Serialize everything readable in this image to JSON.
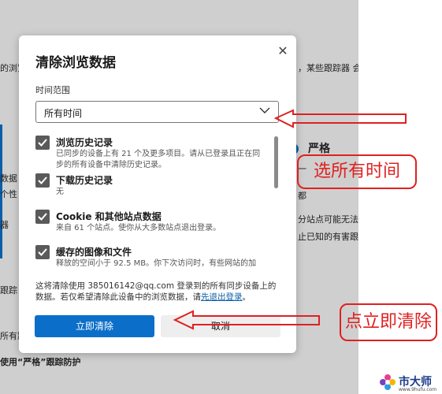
{
  "background": {
    "top_left_text": "的浏览",
    "top_right_text": "，某些跟踪器 会",
    "strict_label": "严格",
    "left_fragments": [
      "数据",
      "个性",
      "器",
      "跟踪",
      "所有跟"
    ],
    "right_fragments": [
      "一",
      "都",
      "分站点可能无法",
      "止已知的有害跟"
    ],
    "bottom_text": "使用“严格”跟踪防护"
  },
  "dialog": {
    "title": "清除浏览数据",
    "close_symbol": "✕",
    "time_range_label": "时间范围",
    "time_range_value": "所有时间",
    "items": [
      {
        "title": "浏览历史记录",
        "desc": "已同步的设备上有 21 个及更多项目。请从已登录且正在同步的所有设备中清除历史记录。",
        "checked": true
      },
      {
        "title": "下载历史记录",
        "desc": "无",
        "checked": true
      },
      {
        "title": "Cookie 和其他站点数据",
        "desc": "来自 61 个站点。使你从大多数站点退出登录。",
        "checked": true
      },
      {
        "title": "缓存的图像和文件",
        "desc": "释放的空间小于 92.5 MB。你下次访问时，有些网站的加",
        "checked": true
      }
    ],
    "sync_note_prefix": "这将清除使用 385016142@qq.com 登录到的所有同步设备上的数据。若仅希望清除此设备中的浏览数据，请",
    "sync_note_link": "先退出登录",
    "sync_note_suffix": "。",
    "clear_button": "立即清除",
    "cancel_button": "取消"
  },
  "annotations": {
    "select_all_time": "选所有时间",
    "click_clear_now": "点立即清除",
    "color": "#e02020"
  },
  "watermark": {
    "text": "市大师",
    "sub": "www.9hufu.com"
  }
}
